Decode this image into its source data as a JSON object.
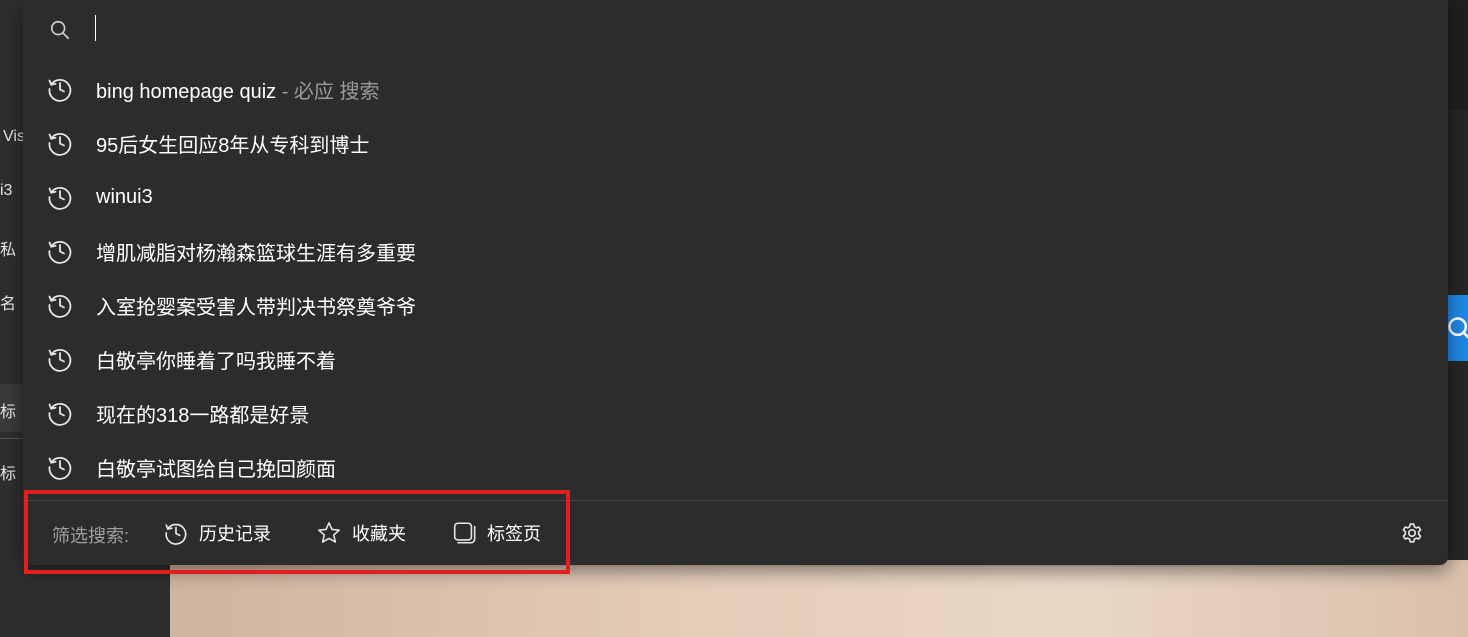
{
  "background": {
    "left_labels": [
      "Vis",
      "i3",
      "私",
      "名",
      "标",
      "标"
    ]
  },
  "search": {
    "value": "",
    "placeholder": ""
  },
  "suggestions": [
    {
      "text": "bing homepage quiz",
      "suffix": " - 必应 搜索"
    },
    {
      "text": "95后女生回应8年从专科到博士",
      "suffix": ""
    },
    {
      "text": "winui3",
      "suffix": ""
    },
    {
      "text": "增肌减脂对杨瀚森篮球生涯有多重要",
      "suffix": ""
    },
    {
      "text": "入室抢婴案受害人带判决书祭奠爷爷",
      "suffix": ""
    },
    {
      "text": "白敬亭你睡着了吗我睡不着",
      "suffix": ""
    },
    {
      "text": "现在的318一路都是好景",
      "suffix": ""
    },
    {
      "text": "白敬亭试图给自己挽回颜面",
      "suffix": ""
    }
  ],
  "filter": {
    "label": "筛选搜索:",
    "history_label": "历史记录",
    "favorites_label": "收藏夹",
    "tabs_label": "标签页"
  },
  "colors": {
    "panel_bg": "#2c2c2c",
    "highlight": "#e0201f",
    "accent": "#1e88e5"
  }
}
